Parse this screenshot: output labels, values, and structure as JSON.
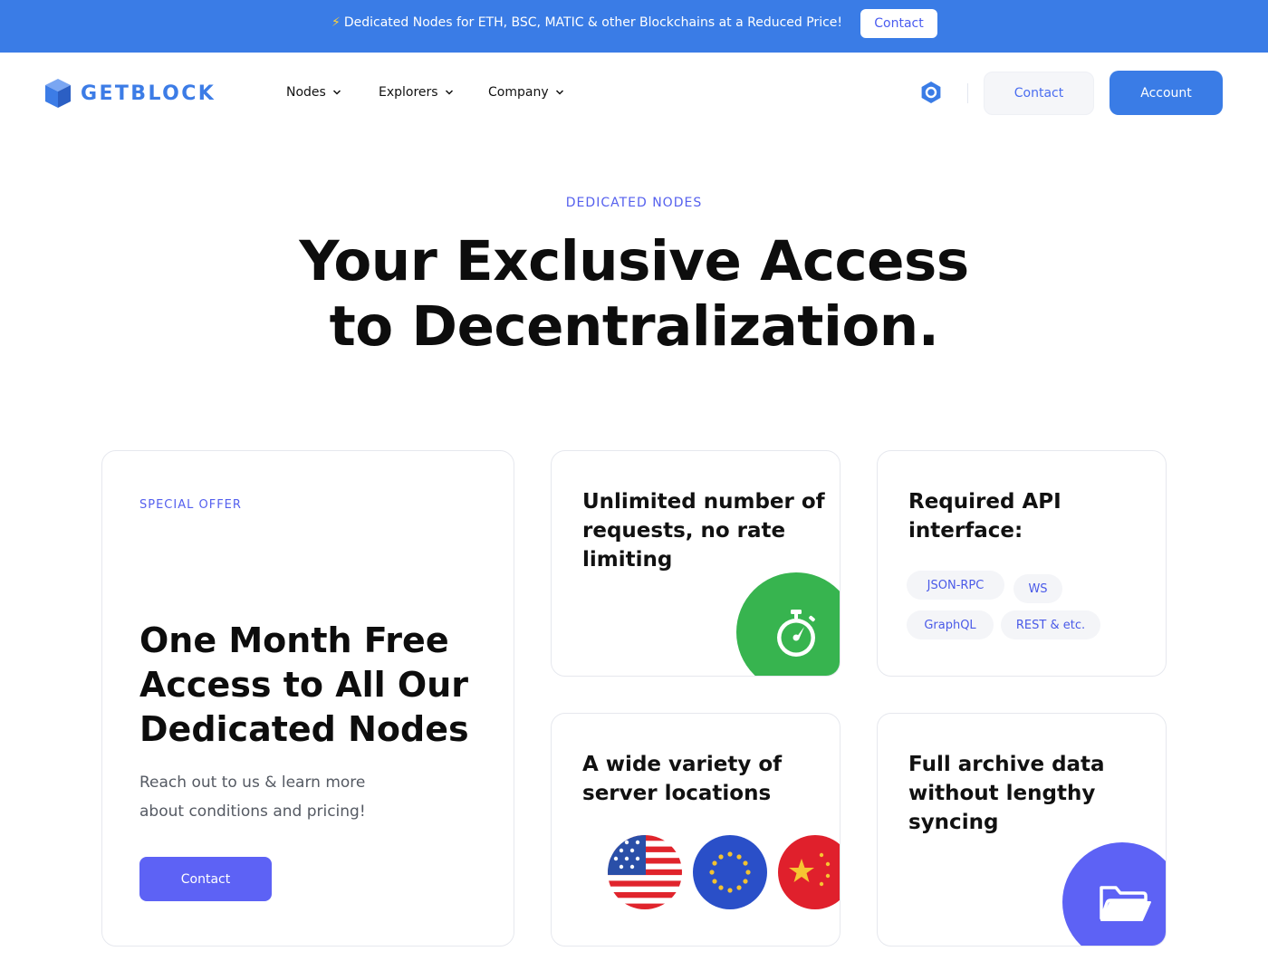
{
  "promo": {
    "bolt": "⚡",
    "text": "Dedicated Nodes for ETH, BSC, MATIC & other Blockchains at a Reduced Price!",
    "button": "Contact"
  },
  "nav": {
    "logo_text": "GETBLOCK",
    "items": [
      {
        "label": "Nodes"
      },
      {
        "label": "Explorers"
      },
      {
        "label": "Company"
      }
    ],
    "contact": "Contact",
    "account": "Account"
  },
  "hero": {
    "eyebrow": "DEDICATED NODES",
    "title_line1": "Your Exclusive Access",
    "title_line2": "to Decentralization."
  },
  "offer": {
    "eyebrow": "SPECIAL OFFER",
    "title": "One Month Free Access to All Our Dedicated Nodes",
    "desc_line1": "Reach out to us & learn more",
    "desc_line2": "about conditions and pricing!",
    "button": "Contact"
  },
  "features": {
    "requests": {
      "title": "Unlimited number of requests, no rate limiting",
      "icon": "stopwatch-icon"
    },
    "api": {
      "title": "Required API interface:",
      "tags": [
        "JSON-RPC",
        "WS",
        "GraphQL",
        "REST & etc."
      ]
    },
    "locations": {
      "title": "A wide variety of server locations",
      "flags": [
        "us-flag",
        "eu-flag",
        "china-flag"
      ]
    },
    "archive": {
      "title": "Full archive data without lengthy syncing",
      "icon": "folder-icon"
    }
  },
  "colors": {
    "brand_blue": "#3a7ce6",
    "accent_purple": "#5d62f5",
    "timer_green": "#37b44f"
  }
}
